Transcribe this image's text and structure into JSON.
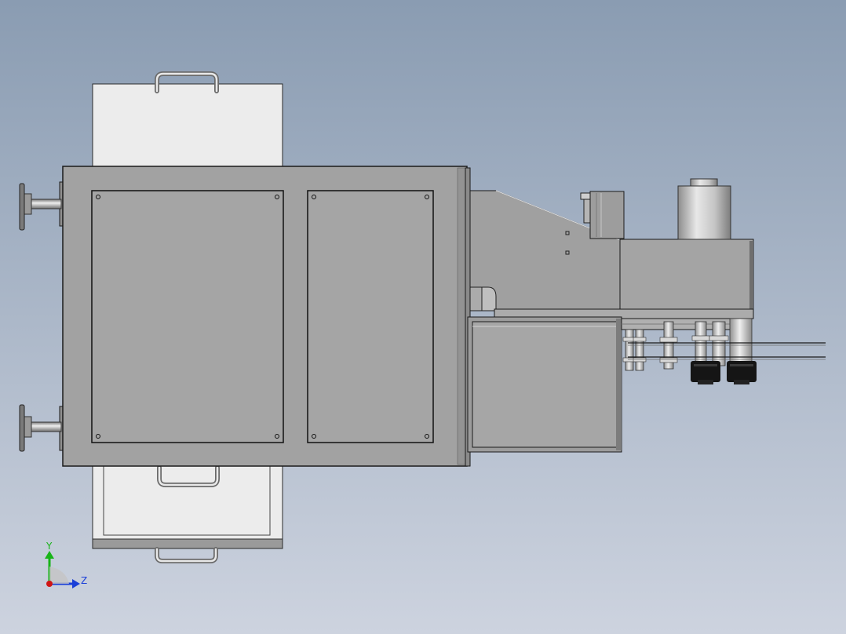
{
  "viewport": {
    "background_top": "#8a9cb2",
    "background_bottom": "#cdd3df"
  },
  "colors": {
    "body": "#a2a2a2",
    "body_dark": "#8f8f8f",
    "panel": "#a5a5a5",
    "drawer": "#ececec",
    "outline": "#1a1a1a",
    "metal_light": "#e2e2e2",
    "metal_mid": "#b9b9b9",
    "knob": "#151515"
  },
  "triad": {
    "y_label": "Y",
    "z_label": "Z",
    "y_color": "#18b418",
    "z_color": "#1a3fd8",
    "x_color": "#d01515"
  }
}
